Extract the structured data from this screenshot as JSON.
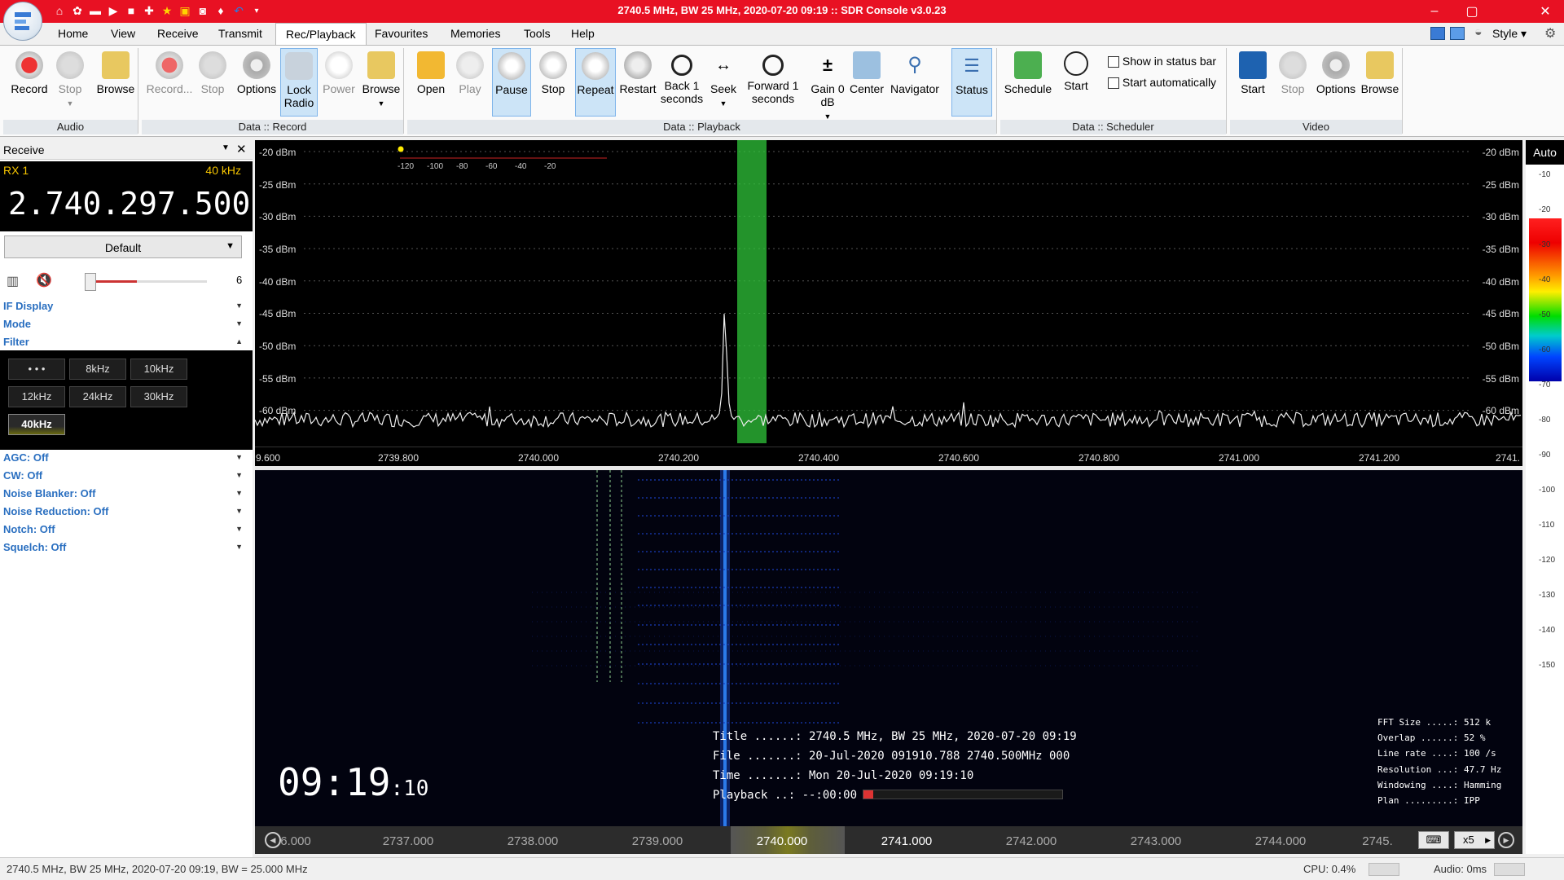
{
  "window": {
    "title": "2740.5 MHz, BW 25 MHz, 2020-07-20 09:19 :: SDR Console v3.0.23",
    "style_label": "Style"
  },
  "menu": {
    "tabs": [
      "Home",
      "View",
      "Receive",
      "Transmit",
      "Rec/Playback",
      "Favourites",
      "Memories",
      "Tools",
      "Help"
    ],
    "active": "Rec/Playback"
  },
  "ribbon": {
    "audio": {
      "label": "Audio",
      "buttons": [
        "Record",
        "Stop",
        "Browse"
      ]
    },
    "data_record": {
      "label": "Data :: Record",
      "buttons": [
        "Record...",
        "Stop",
        "Options",
        "Lock Radio",
        "Power",
        "Browse"
      ]
    },
    "data_playback": {
      "label": "Data :: Playback",
      "buttons": [
        "Open",
        "Play",
        "Pause",
        "Stop",
        "Repeat",
        "Restart",
        "Back 1 seconds",
        "Seek",
        "Forward 1 seconds",
        "Gain 0 dB",
        "Center",
        "Navigator",
        "Status"
      ]
    },
    "data_scheduler": {
      "label": "Data :: Scheduler",
      "buttons": [
        "Schedule",
        "Start"
      ],
      "checkboxes": [
        "Show in status bar",
        "Start automatically"
      ]
    },
    "video": {
      "label": "Video",
      "buttons": [
        "Start",
        "Stop",
        "Options",
        "Browse"
      ]
    }
  },
  "receive_panel": {
    "header": "Receive",
    "rx_label": "RX 1",
    "bandwidth": "40 kHz",
    "frequency": "2.740.297.500",
    "preset": "Default",
    "volume": "6",
    "sections": [
      "IF Display",
      "Mode",
      "Filter"
    ],
    "filters": [
      "• • •",
      "8kHz",
      "10kHz",
      "12kHz",
      "24kHz",
      "30kHz",
      "40kHz"
    ],
    "active_filter": "40kHz",
    "options": [
      "AGC: Off",
      "CW: Off",
      "Noise Blanker: Off",
      "Noise Reduction: Off",
      "Notch: Off",
      "Squelch: Off"
    ]
  },
  "spectrum": {
    "db_labels": [
      "-20 dBm",
      "-25 dBm",
      "-30 dBm",
      "-35 dBm",
      "-40 dBm",
      "-45 dBm",
      "-50 dBm",
      "-55 dBm",
      "-60 dBm"
    ],
    "freq_labels": [
      "9.600",
      "2739.800",
      "2740.000",
      "2740.200",
      "2740.400",
      "2740.600",
      "2740.800",
      "2741.000",
      "2741.200",
      "2741."
    ],
    "mini_scale": [
      "-120",
      "-100",
      "-80",
      "-60",
      "-40",
      "-20"
    ],
    "auto_label": "Auto"
  },
  "colorbar": {
    "labels": [
      "-10",
      "-20",
      "-30",
      "-40",
      "-50",
      "-60",
      "-70",
      "-80",
      "-90",
      "-100",
      "-110",
      "-120",
      "-130",
      "-140",
      "-150"
    ]
  },
  "waterfall": {
    "clock_main": "09:19",
    "clock_sec": ":10",
    "info": [
      "Title ......: 2740.5 MHz, BW 25 MHz, 2020-07-20 09:19",
      "File .......: 20-Jul-2020 091910.788 2740.500MHz 000",
      "Time .......: Mon 20-Jul-2020 09:19:10",
      "Playback ..: --:00:00"
    ],
    "stats": [
      "FFT Size .....: 512 k",
      "Overlap ......: 52 %",
      "Line rate ....: 100 /s",
      "Resolution ...: 47.7 Hz",
      "Windowing ....: Hamming",
      "Plan .........: IPP"
    ]
  },
  "bottom_scale": {
    "labels": [
      "6.000",
      "2737.000",
      "2738.000",
      "2739.000",
      "2740.000",
      "2741.000",
      "2742.000",
      "2743.000",
      "2744.000",
      "2745."
    ],
    "zoom": "x5"
  },
  "status": {
    "text": "2740.5 MHz, BW 25 MHz, 2020-07-20 09:19, BW = 25.000 MHz",
    "cpu": "CPU: 0.4%",
    "audio": "Audio: 0ms"
  }
}
